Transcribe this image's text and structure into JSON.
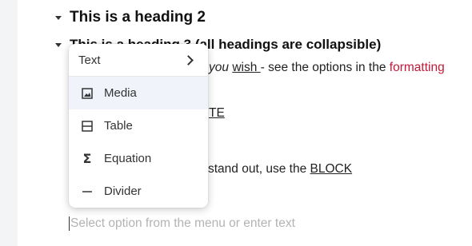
{
  "document": {
    "heading2": "This is a heading 2",
    "heading3": "This is a heading 3 (all headings are collapsible)",
    "para1": {
      "italic": "you",
      "space": " ",
      "link": "wish ",
      "text": "- see the options in the ",
      "red": "formatting"
    },
    "para2_tail": "TE",
    "para3": {
      "text": "stand out, use the ",
      "link": "BLOCK"
    },
    "placeholder": "Select option from the menu or enter text"
  },
  "menu": {
    "top_label": "Text",
    "items": [
      {
        "label": "Media",
        "icon": "image-icon",
        "active": true
      },
      {
        "label": "Table",
        "icon": "table-icon"
      },
      {
        "label": "Equation",
        "icon": "sigma-icon"
      },
      {
        "label": "Divider",
        "icon": "divider-icon"
      }
    ]
  },
  "colors": {
    "accent_red": "#c2183a",
    "hover_bg": "#f0f4fa"
  }
}
